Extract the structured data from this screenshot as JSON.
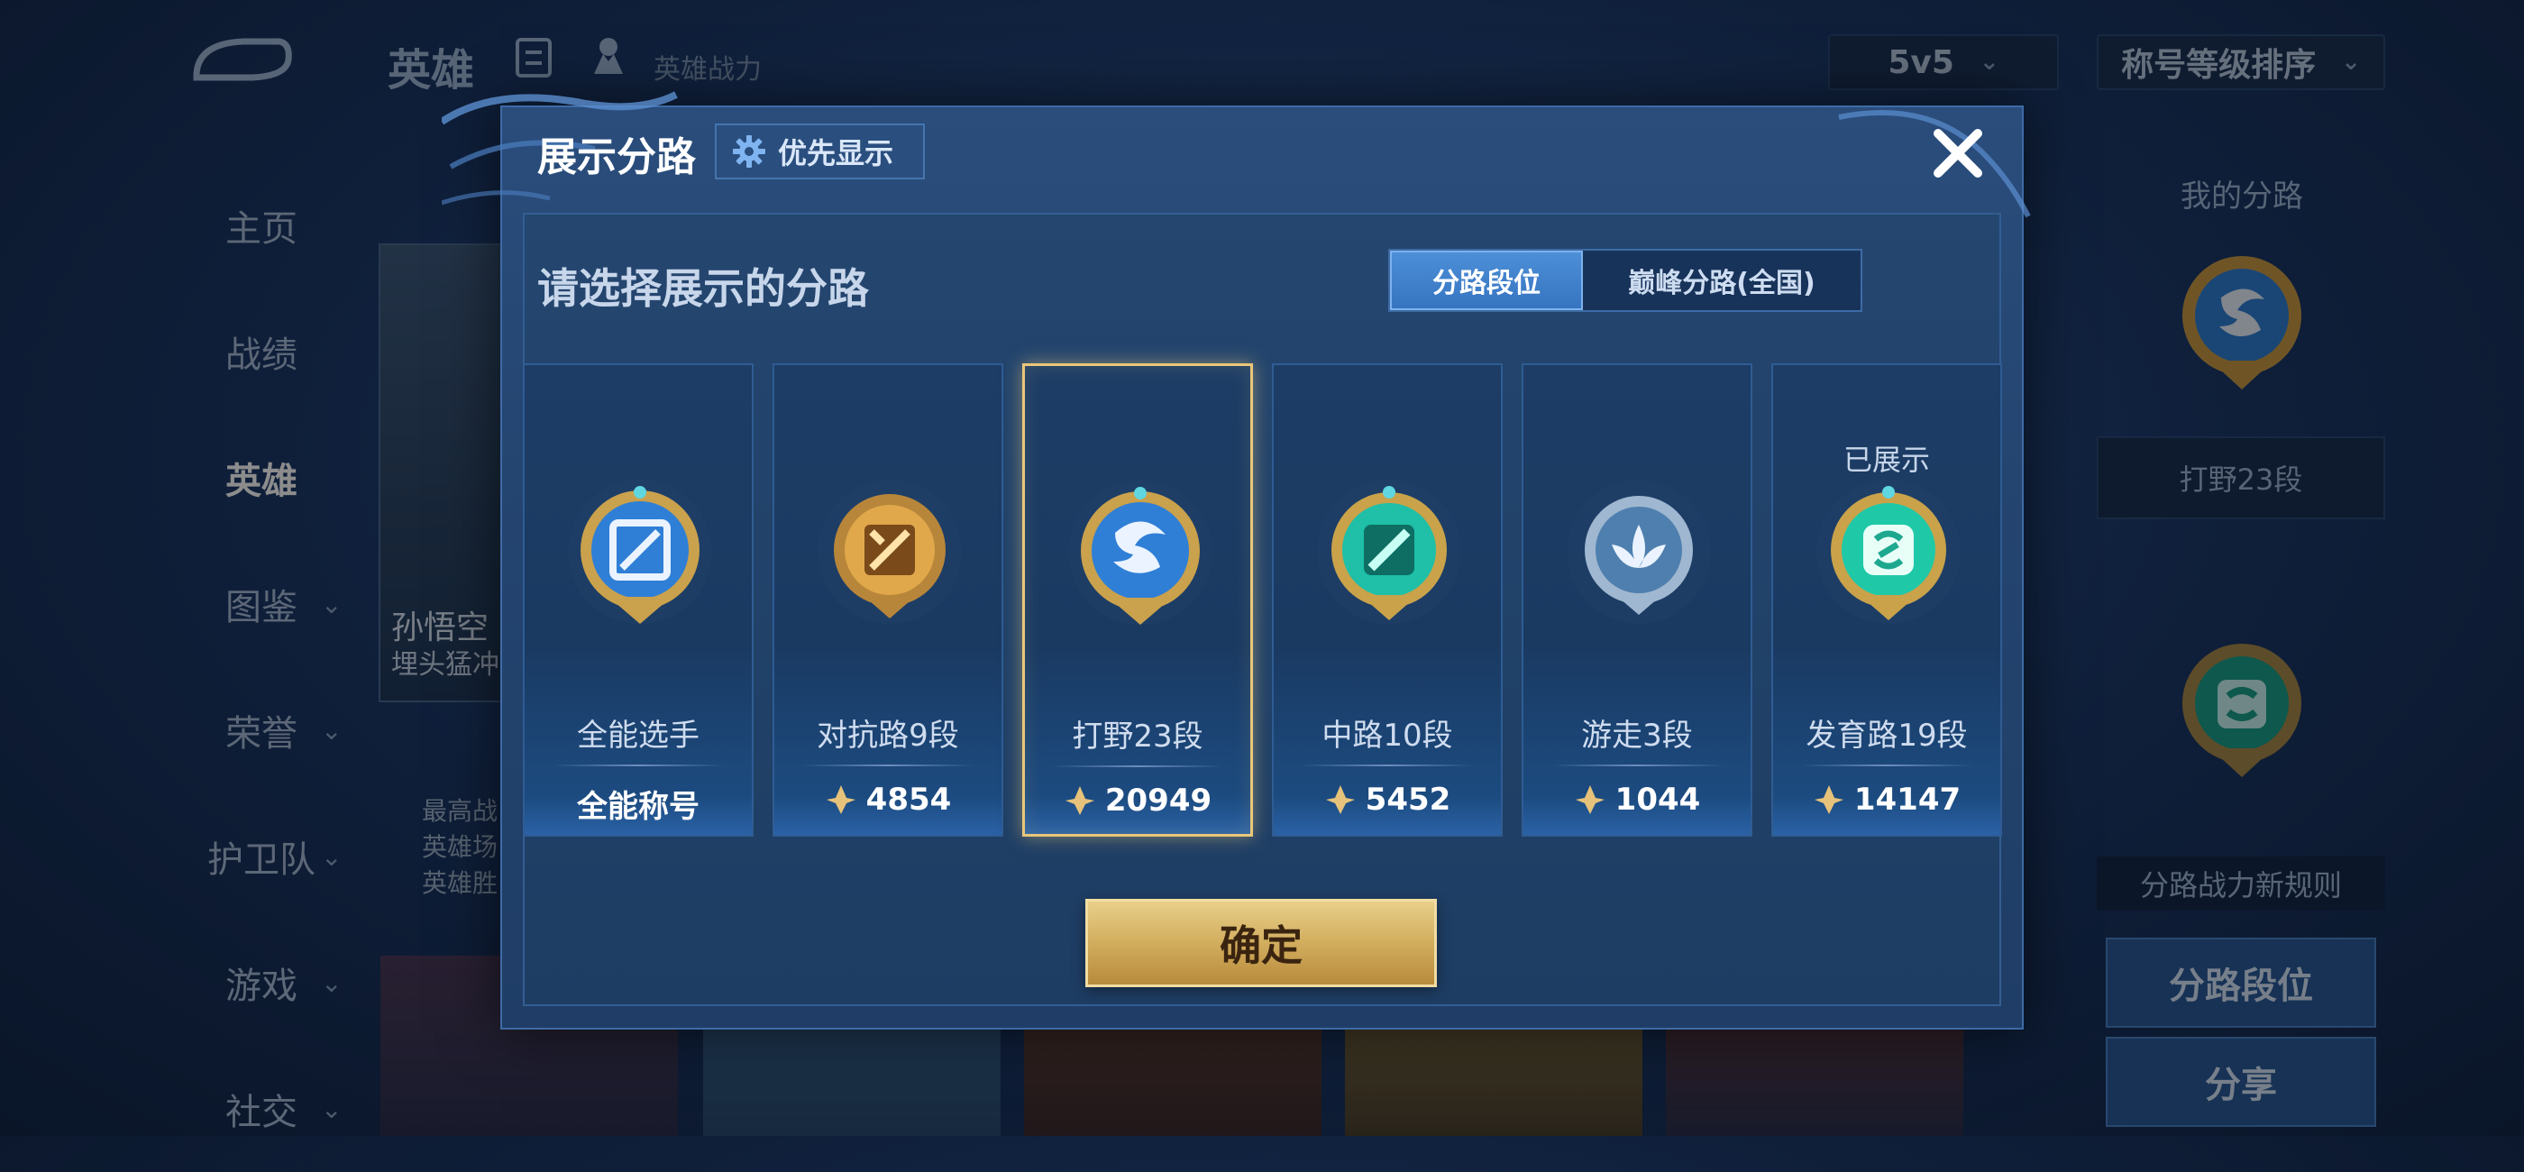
{
  "background": {
    "top_title": "英雄",
    "power_label": "英雄战力",
    "mode_select": "5v5",
    "sort_select": "称号等级排序",
    "nav": [
      {
        "label": "主页",
        "chevron": false,
        "active": false
      },
      {
        "label": "战绩",
        "chevron": false,
        "active": false
      },
      {
        "label": "英雄",
        "chevron": false,
        "active": true
      },
      {
        "label": "图鉴",
        "chevron": true,
        "active": false
      },
      {
        "label": "荣誉",
        "chevron": true,
        "active": false
      },
      {
        "label": "护卫队",
        "chevron": true,
        "active": false
      },
      {
        "label": "游戏",
        "chevron": true,
        "active": false
      },
      {
        "label": "社交",
        "chevron": true,
        "active": false
      }
    ],
    "hero_card": {
      "name": "孙悟空",
      "subtitle": "埋头猛冲"
    },
    "hero_info": [
      "最高战",
      "英雄场",
      "英雄胜"
    ],
    "right_panel": {
      "title": "我的分路",
      "current_lane": "打野23段",
      "rule": "分路战力新规则",
      "btn_lane_rank": "分路段位",
      "btn_share": "分享"
    }
  },
  "modal": {
    "title": "展示分路",
    "priority_button": "优先显示",
    "instruction": "请选择展示的分路",
    "tabs": [
      {
        "label": "分路段位",
        "active": true
      },
      {
        "label": "巅峰分路(全国)",
        "active": false
      }
    ],
    "cards": [
      {
        "name": "全能选手",
        "score": "全能称号",
        "has_power_icon": false,
        "shown_label": "",
        "selected": false,
        "emblem": "allround-emblem-icon",
        "color": "#2f7fd6"
      },
      {
        "name": "对抗路9段",
        "score": "4854",
        "has_power_icon": true,
        "shown_label": "",
        "selected": false,
        "emblem": "clash-lane-emblem-icon",
        "color": "#d49a3a"
      },
      {
        "name": "打野23段",
        "score": "20949",
        "has_power_icon": true,
        "shown_label": "",
        "selected": true,
        "emblem": "jungle-emblem-icon",
        "color": "#2f7fd6"
      },
      {
        "name": "中路10段",
        "score": "5452",
        "has_power_icon": true,
        "shown_label": "",
        "selected": false,
        "emblem": "mid-lane-emblem-icon",
        "color": "#1fbfa8"
      },
      {
        "name": "游走3段",
        "score": "1044",
        "has_power_icon": true,
        "shown_label": "",
        "selected": false,
        "emblem": "roam-emblem-icon",
        "color": "#8fb2d6"
      },
      {
        "name": "发育路19段",
        "score": "14147",
        "has_power_icon": true,
        "shown_label": "已展示",
        "selected": false,
        "emblem": "farm-lane-emblem-icon",
        "color": "#1fc9a8"
      }
    ],
    "confirm_button": "确定"
  },
  "colors": {
    "accent_gold": "#d2ad5e",
    "tab_active": "#3674c0",
    "modal_bg": "#244570"
  }
}
